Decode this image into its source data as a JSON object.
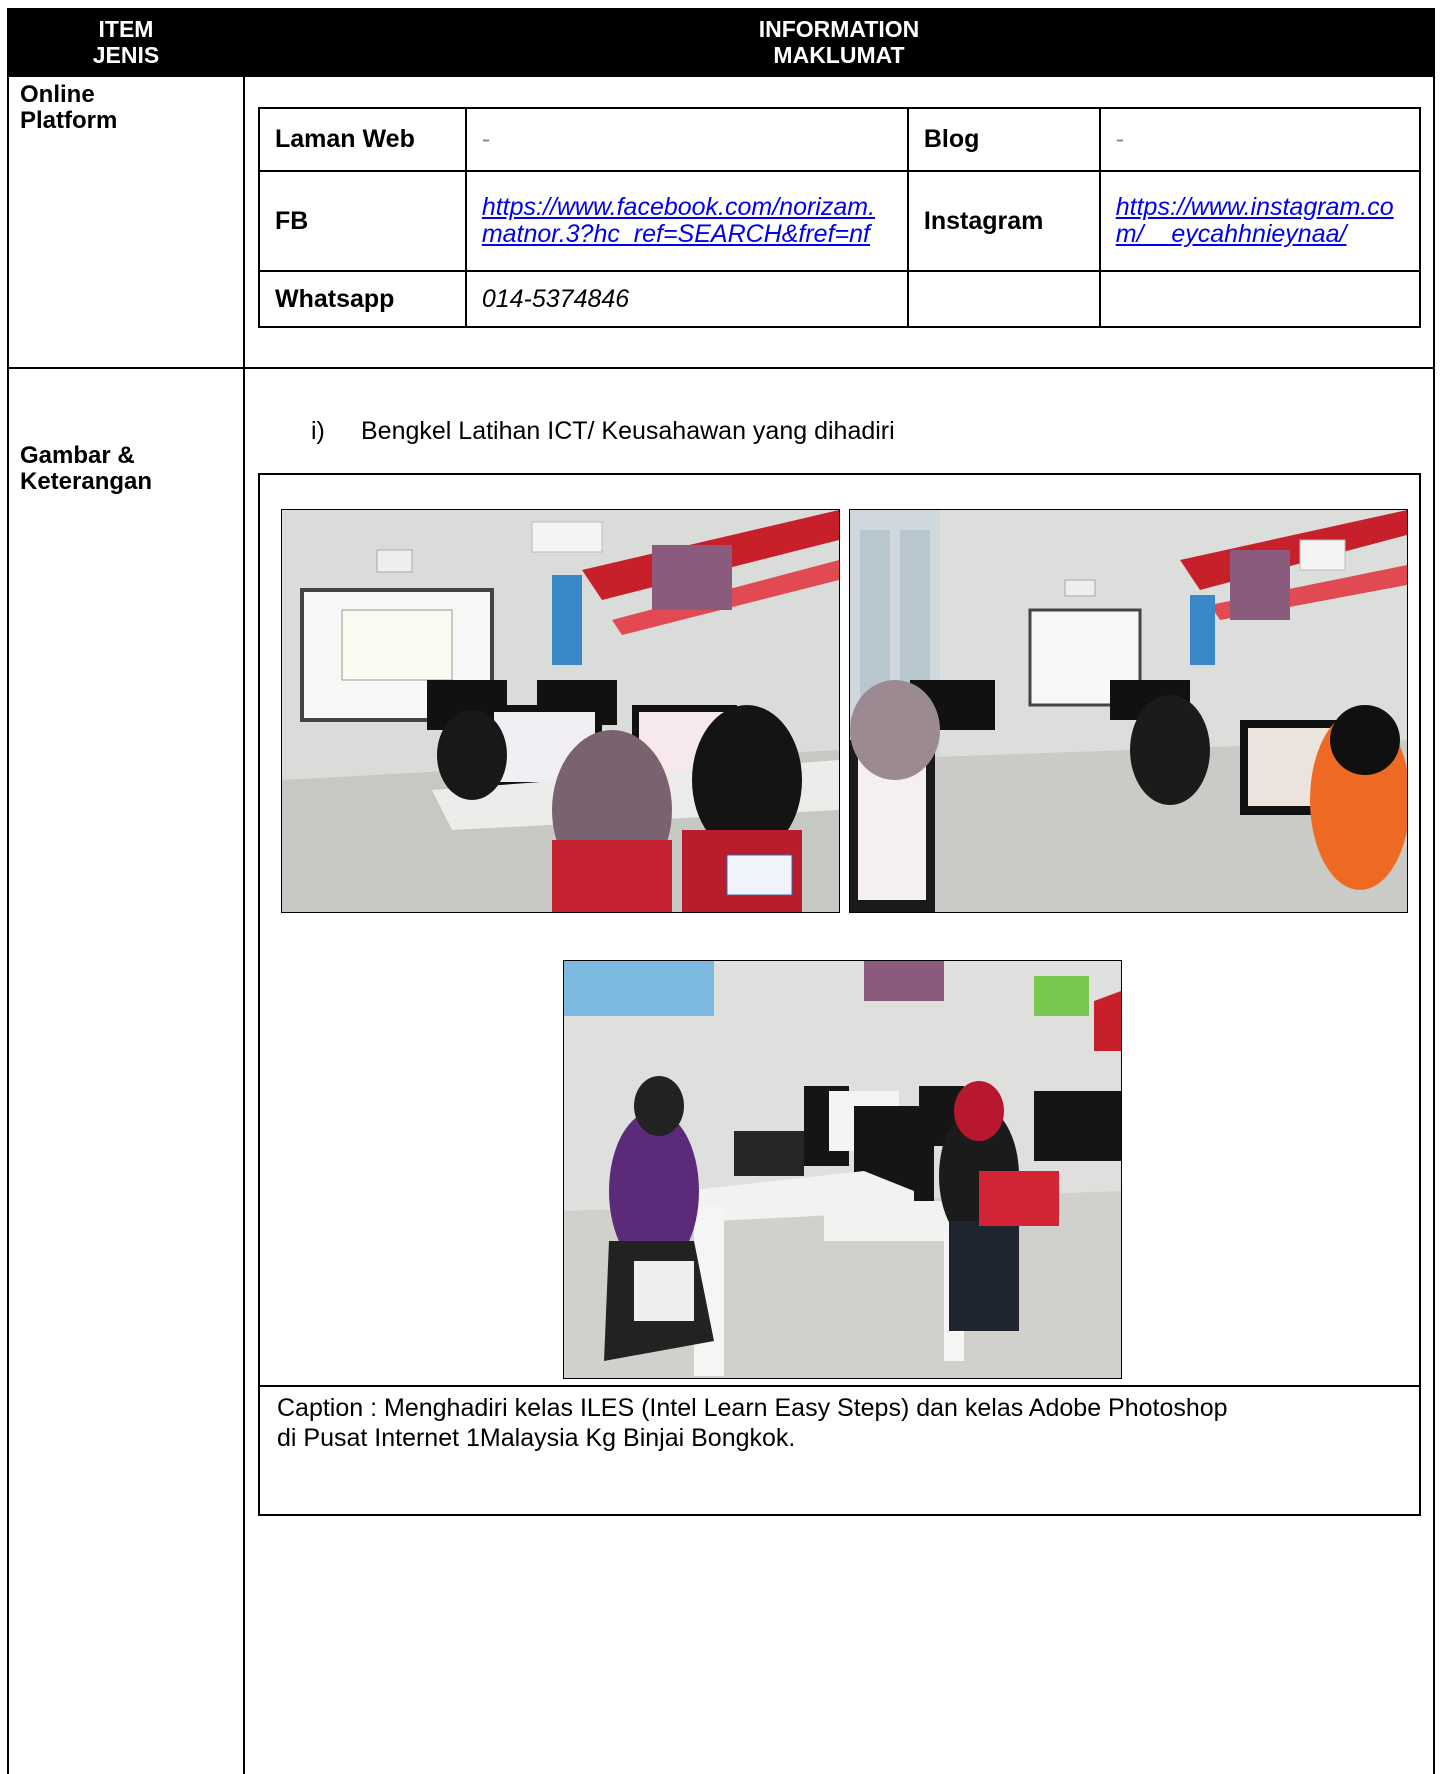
{
  "header": {
    "col1_line1": "ITEM",
    "col1_line2": "JENIS",
    "col2_line1": "INFORMATION",
    "col2_line2": "MAKLUMAT"
  },
  "online_platform": {
    "label_line1": "Online",
    "label_line2": "Platform",
    "rows": [
      {
        "k1": "Laman Web",
        "v1": "-",
        "k2": "Blog",
        "v2": "-"
      },
      {
        "k1": "FB",
        "v1": "https://www.facebook.com/norizam.matnor.3?hc_ref=SEARCH&fref=nf",
        "k2": "Instagram",
        "v2": "https://www.instagram.com/__eycahhnieynaa/"
      },
      {
        "k1": "Whatsapp",
        "v1": "014-5374846",
        "k2": "",
        "v2": ""
      }
    ]
  },
  "gambar": {
    "label_line1": "Gambar &",
    "label_line2": "Keterangan",
    "item_number": "i)",
    "item_text": "Bengkel Latihan ICT/ Keusahawan yang dihadiri",
    "caption_line1": "Caption : Menghadiri kelas ILES (Intel Learn Easy Steps) dan kelas Adobe Photoshop",
    "caption_line2": "di Pusat Internet 1Malaysia Kg Binjai Bongkok.",
    "colors": {
      "wall": "#d9dcd8",
      "floor": "#c6c8c3",
      "red_stripe": "#c8202a",
      "monitor": "#1b1b1d",
      "desk": "#ececea"
    }
  }
}
